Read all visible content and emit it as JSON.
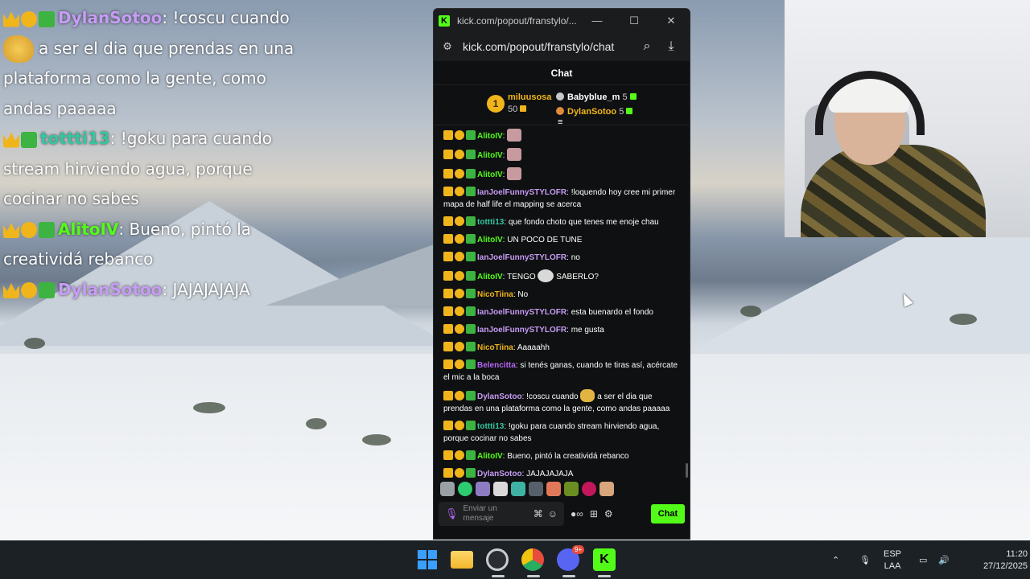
{
  "overlay": {
    "lines": [
      {
        "user": "DylanSotoo",
        "color": "#c79cf5",
        "text": "!coscu cuando",
        "emote": "dog-emote",
        "text2": "a ser el dia que prendas en una plataforma como la gente, como andas paaaaa"
      },
      {
        "user": "tottti13",
        "color": "#35c6a0",
        "text": ": !goku para cuando stream hirviendo agua, porque cocinar no sabes"
      },
      {
        "user": "AlitoIV",
        "color": "#53fc18",
        "text": ": Bueno, pintó la creatividá rebanco"
      },
      {
        "user": "DylanSotoo",
        "color": "#c79cf5",
        "text": ": JAJAJAJAJA"
      }
    ]
  },
  "window": {
    "tab_title": "kick.com/popout/franstylo/...",
    "url": "kick.com/popout/franstylo/chat",
    "minimize": "—",
    "maximize": "☐",
    "close": "✕"
  },
  "chat": {
    "header": "Chat",
    "leaderboard": {
      "first": {
        "rank": "1",
        "name": "miluusosa",
        "points": "50"
      },
      "others": [
        {
          "name": "Babyblue_m",
          "points": "5",
          "dot_color": "#c7c8ca",
          "name_color": "#ffffff"
        },
        {
          "name": "DylanSotoo",
          "points": "5",
          "dot_color": "#e08a3c",
          "name_color": "#f0b51b"
        }
      ]
    },
    "messages": [
      {
        "user": "AlitoIV",
        "color": "#53fc18",
        "text": "",
        "emote": "pink"
      },
      {
        "user": "AlitoIV",
        "color": "#53fc18",
        "text": "",
        "emote": "pink"
      },
      {
        "user": "AlitoIV",
        "color": "#53fc18",
        "text": "",
        "emote": "pink"
      },
      {
        "user": "IanJoelFunnySTYLOFR",
        "color": "#c79cf5",
        "text": "!loquendo hoy cree mi primer mapa de half life el mapping se acerca"
      },
      {
        "user": "tottti13",
        "color": "#35c6a0",
        "text": "que fondo choto que tenes me enoje chau"
      },
      {
        "user": "AlitoIV",
        "color": "#53fc18",
        "text": "UN POCO DE TUNE"
      },
      {
        "user": "IanJoelFunnySTYLOFR",
        "color": "#c79cf5",
        "text": "no"
      },
      {
        "user": "AlitoIV",
        "color": "#53fc18",
        "text": "TENGO",
        "emote": "troll",
        "text2": "SABERLO?"
      },
      {
        "user": "NicoTiina",
        "color": "#f0b51b",
        "text": "No"
      },
      {
        "user": "IanJoelFunnySTYLOFR",
        "color": "#c79cf5",
        "text": "esta buenardo el fondo"
      },
      {
        "user": "IanJoelFunnySTYLOFR",
        "color": "#c79cf5",
        "text": "me gusta"
      },
      {
        "user": "NicoTiina",
        "color": "#f0b51b",
        "text": "Aaaaahh"
      },
      {
        "user": "Belencitta",
        "color": "#b565f5",
        "text": "si tenés ganas, cuando te tiras así, acércate el mic a la boca"
      },
      {
        "user": "DylanSotoo",
        "color": "#c79cf5",
        "text": "!coscu cuando",
        "emote": "dog",
        "text2": "a ser el dia que prendas en una plataforma como la gente, como andas paaaaa"
      },
      {
        "user": "tottti13",
        "color": "#35c6a0",
        "text": "!goku para cuando stream hirviendo agua, porque cocinar no sabes"
      },
      {
        "user": "AlitoIV",
        "color": "#53fc18",
        "text": "Bueno, pintó la creatividá rebanco"
      },
      {
        "user": "DylanSotoo",
        "color": "#c79cf5",
        "text": "JAJAJAJAJA"
      }
    ],
    "input_placeholder": "Enviar un mensaje",
    "send_label": "Chat"
  },
  "taskbar": {
    "discord_badge": "9+",
    "lang_top": "ESP",
    "lang_bottom": "LAA",
    "time": "11:20",
    "date": "27/12/2025"
  },
  "colors": {
    "kick_green": "#53fc18",
    "window_bg": "#0f1011",
    "taskbar_bg": "#1c2126"
  }
}
